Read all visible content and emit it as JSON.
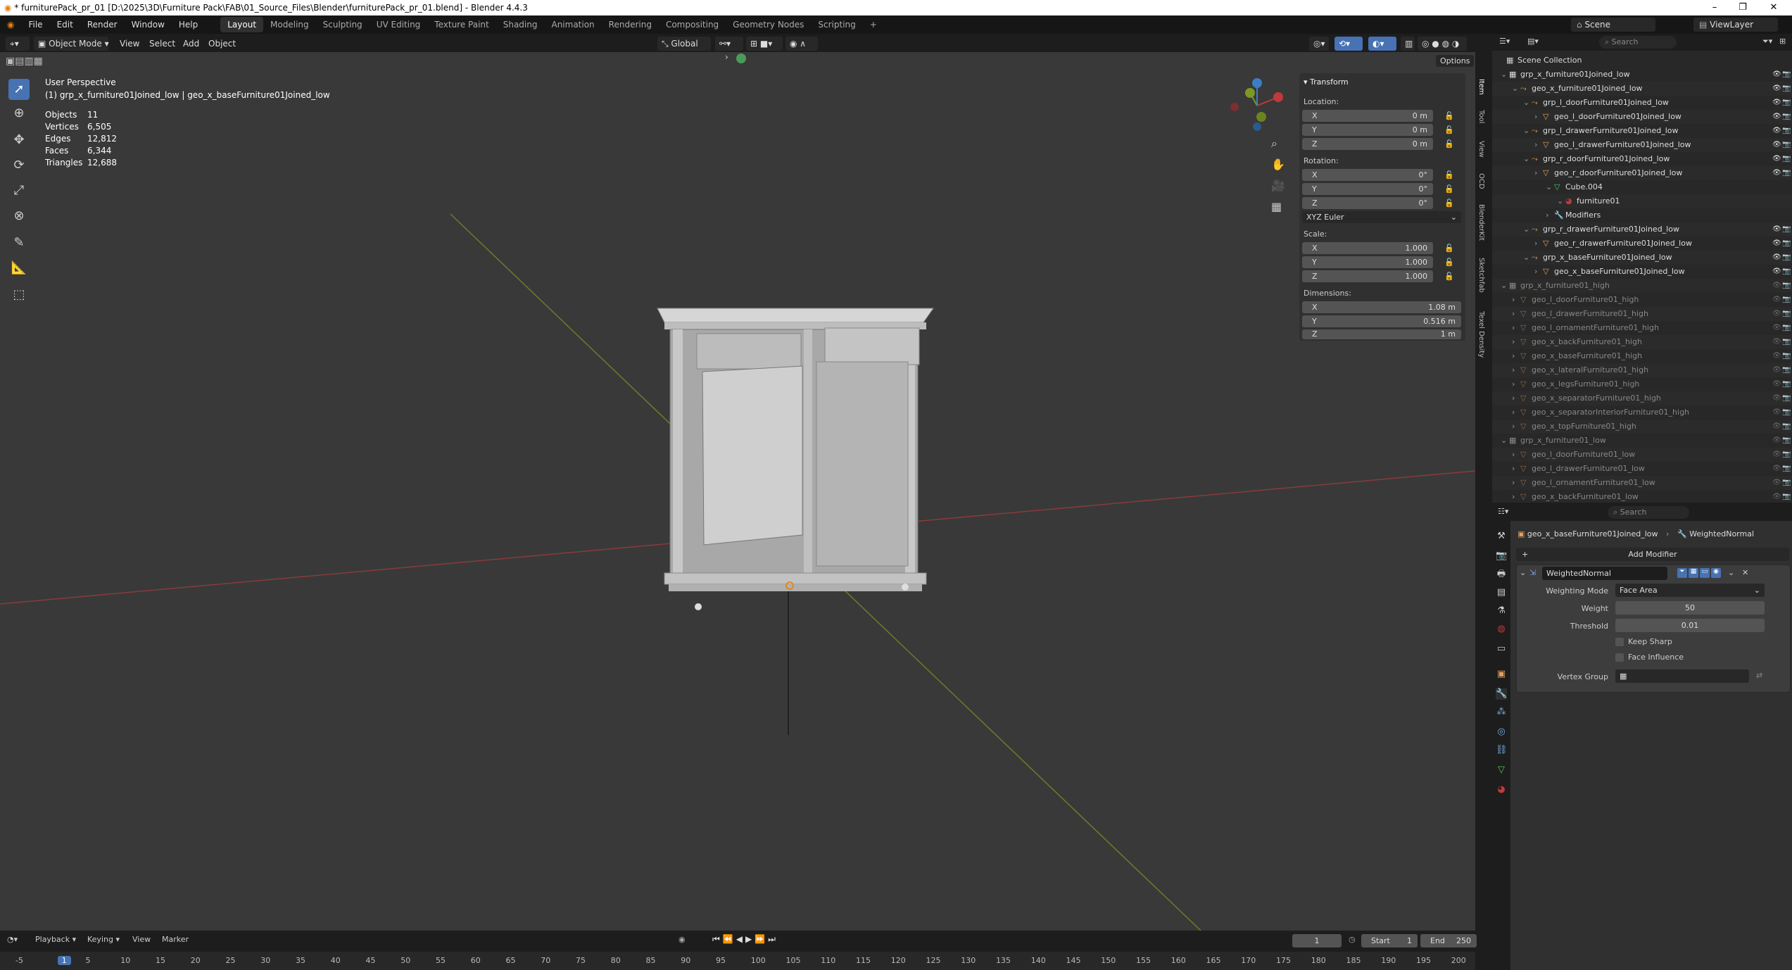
{
  "window": {
    "title": "* furniturePack_pr_01 [D:\\2025\\3D\\Furniture Pack\\FAB\\01_Source_Files\\Blender\\furniturePack_pr_01.blend] - Blender 4.4.3",
    "minimize": "–",
    "maximize": "❐",
    "close": "✕"
  },
  "menu": [
    "File",
    "Edit",
    "Render",
    "Window",
    "Help"
  ],
  "workspaces": [
    "Layout",
    "Modeling",
    "Sculpting",
    "UV Editing",
    "Texture Paint",
    "Shading",
    "Animation",
    "Rendering",
    "Compositing",
    "Geometry Nodes",
    "Scripting"
  ],
  "scene": {
    "label": "Scene",
    "viewlayer": "ViewLayer"
  },
  "viewport_header": {
    "mode": "Object Mode",
    "menus": [
      "View",
      "Select",
      "Add",
      "Object"
    ],
    "orientation": "Global",
    "options": "Options"
  },
  "overlay_text": {
    "perspective": "User Perspective",
    "context": "(1) grp_x_furniture01Joined_low | geo_x_baseFurniture01Joined_low"
  },
  "stats": [
    {
      "label": "Objects",
      "value": "11"
    },
    {
      "label": "Vertices",
      "value": "6,505"
    },
    {
      "label": "Edges",
      "value": "12,812"
    },
    {
      "label": "Faces",
      "value": "6,344"
    },
    {
      "label": "Triangles",
      "value": "12,688"
    }
  ],
  "transform": {
    "title": "Transform",
    "location_label": "Location:",
    "location": [
      {
        "axis": "X",
        "value": "0 m"
      },
      {
        "axis": "Y",
        "value": "0 m"
      },
      {
        "axis": "Z",
        "value": "0 m"
      }
    ],
    "rotation_label": "Rotation:",
    "rotation": [
      {
        "axis": "X",
        "value": "0°"
      },
      {
        "axis": "Y",
        "value": "0°"
      },
      {
        "axis": "Z",
        "value": "0°"
      }
    ],
    "rotation_mode": "XYZ Euler",
    "scale_label": "Scale:",
    "scale": [
      {
        "axis": "X",
        "value": "1.000"
      },
      {
        "axis": "Y",
        "value": "1.000"
      },
      {
        "axis": "Z",
        "value": "1.000"
      }
    ],
    "dimensions_label": "Dimensions:",
    "dimensions": [
      {
        "axis": "X",
        "value": "1.08 m"
      },
      {
        "axis": "Y",
        "value": "0.516 m"
      },
      {
        "axis": "Z",
        "value": "1 m"
      }
    ]
  },
  "npanel_tabs": [
    "Item",
    "Tool",
    "View",
    "OCD",
    "BlenderKit",
    "Sketchfab",
    "Texel Density"
  ],
  "outliner": {
    "search_placeholder": "Search",
    "root": "Scene Collection",
    "rows": [
      {
        "name": "grp_x_furniture01Joined_low",
        "type": "collection",
        "indent": 1
      },
      {
        "name": "geo_x_furniture01Joined_low",
        "type": "empty",
        "indent": 2
      },
      {
        "name": "grp_l_doorFurniture01Joined_low",
        "type": "empty",
        "indent": 3
      },
      {
        "name": "geo_l_doorFurniture01Joined_low",
        "type": "mesh",
        "indent": 4
      },
      {
        "name": "grp_l_drawerFurniture01Joined_low",
        "type": "empty",
        "indent": 3
      },
      {
        "name": "geo_l_drawerFurniture01Joined_low",
        "type": "mesh",
        "indent": 4
      },
      {
        "name": "grp_r_doorFurniture01Joined_low",
        "type": "empty",
        "indent": 3
      },
      {
        "name": "geo_r_doorFurniture01Joined_low",
        "type": "mesh",
        "indent": 4
      },
      {
        "name": "Cube.004",
        "type": "data",
        "indent": 5
      },
      {
        "name": "furniture01",
        "type": "material",
        "indent": 6
      },
      {
        "name": "Modifiers",
        "type": "modifiers",
        "indent": 5
      },
      {
        "name": "grp_r_drawerFurniture01Joined_low",
        "type": "empty",
        "indent": 3
      },
      {
        "name": "geo_r_drawerFurniture01Joined_low",
        "type": "mesh",
        "indent": 4
      },
      {
        "name": "grp_x_baseFurniture01Joined_low",
        "type": "empty",
        "indent": 3
      },
      {
        "name": "geo_x_baseFurniture01Joined_low",
        "type": "mesh",
        "indent": 4
      },
      {
        "name": "grp_x_furniture01_high",
        "type": "collection-dim",
        "indent": 1
      },
      {
        "name": "geo_l_doorFurniture01_high",
        "type": "mesh-dim",
        "indent": 2
      },
      {
        "name": "geo_l_drawerFurniture01_high",
        "type": "mesh-dim",
        "indent": 2
      },
      {
        "name": "geo_l_ornamentFurniture01_high",
        "type": "mesh-dim",
        "indent": 2
      },
      {
        "name": "geo_x_backFurniture01_high",
        "type": "mesh-dim",
        "indent": 2
      },
      {
        "name": "geo_x_baseFurniture01_high",
        "type": "mesh-dim",
        "indent": 2
      },
      {
        "name": "geo_x_lateralFurniture01_high",
        "type": "mesh-dim",
        "indent": 2
      },
      {
        "name": "geo_x_legsFurniture01_high",
        "type": "mesh-dim",
        "indent": 2
      },
      {
        "name": "geo_x_separatorFurniture01_high",
        "type": "mesh-dim",
        "indent": 2
      },
      {
        "name": "geo_x_separatorInteriorFurniture01_high",
        "type": "mesh-dim",
        "indent": 2
      },
      {
        "name": "geo_x_topFurniture01_high",
        "type": "mesh-dim",
        "indent": 2
      },
      {
        "name": "grp_x_furniture01_low",
        "type": "collection-dim",
        "indent": 1
      },
      {
        "name": "geo_l_doorFurniture01_low",
        "type": "mesh-dim",
        "indent": 2
      },
      {
        "name": "geo_l_drawerFurniture01_low",
        "type": "mesh-dim",
        "indent": 2
      },
      {
        "name": "geo_l_ornamentFurniture01_low",
        "type": "mesh-dim",
        "indent": 2
      },
      {
        "name": "geo_x_backFurniture01_low",
        "type": "mesh-dim",
        "indent": 2
      }
    ]
  },
  "properties": {
    "search_placeholder": "Search",
    "breadcrumb_object": "geo_x_baseFurniture01Joined_low",
    "breadcrumb_modifier": "WeightedNormal",
    "add_modifier": "Add Modifier",
    "modifier_name": "WeightedNormal",
    "weighting_mode_label": "Weighting Mode",
    "weighting_mode": "Face Area",
    "weight_label": "Weight",
    "weight": "50",
    "threshold_label": "Threshold",
    "threshold": "0.01",
    "keep_sharp": "Keep Sharp",
    "face_influence": "Face Influence",
    "vertex_group_label": "Vertex Group"
  },
  "timeline": {
    "menus": [
      "Playback",
      "Keying",
      "View",
      "Marker"
    ],
    "current_frame": "1",
    "start_label": "Start",
    "start": "1",
    "end_label": "End",
    "end": "250",
    "ticks": [
      "-5",
      "1",
      "5",
      "10",
      "15",
      "20",
      "25",
      "30",
      "35",
      "40",
      "45",
      "50",
      "55",
      "60",
      "65",
      "70",
      "75",
      "80",
      "85",
      "90",
      "95",
      "100",
      "105",
      "110",
      "115",
      "120",
      "125",
      "130",
      "135",
      "140",
      "145",
      "150",
      "155",
      "160",
      "165",
      "170",
      "175",
      "180",
      "185",
      "190",
      "195",
      "200"
    ]
  },
  "colors": {
    "accent": "#4772b3",
    "x_axis": "#c0393b",
    "y_axis": "#7a9a23",
    "z_axis": "#3a7fc4",
    "mesh_icon": "#e2a05a",
    "collection_icon": "#cccccc"
  }
}
